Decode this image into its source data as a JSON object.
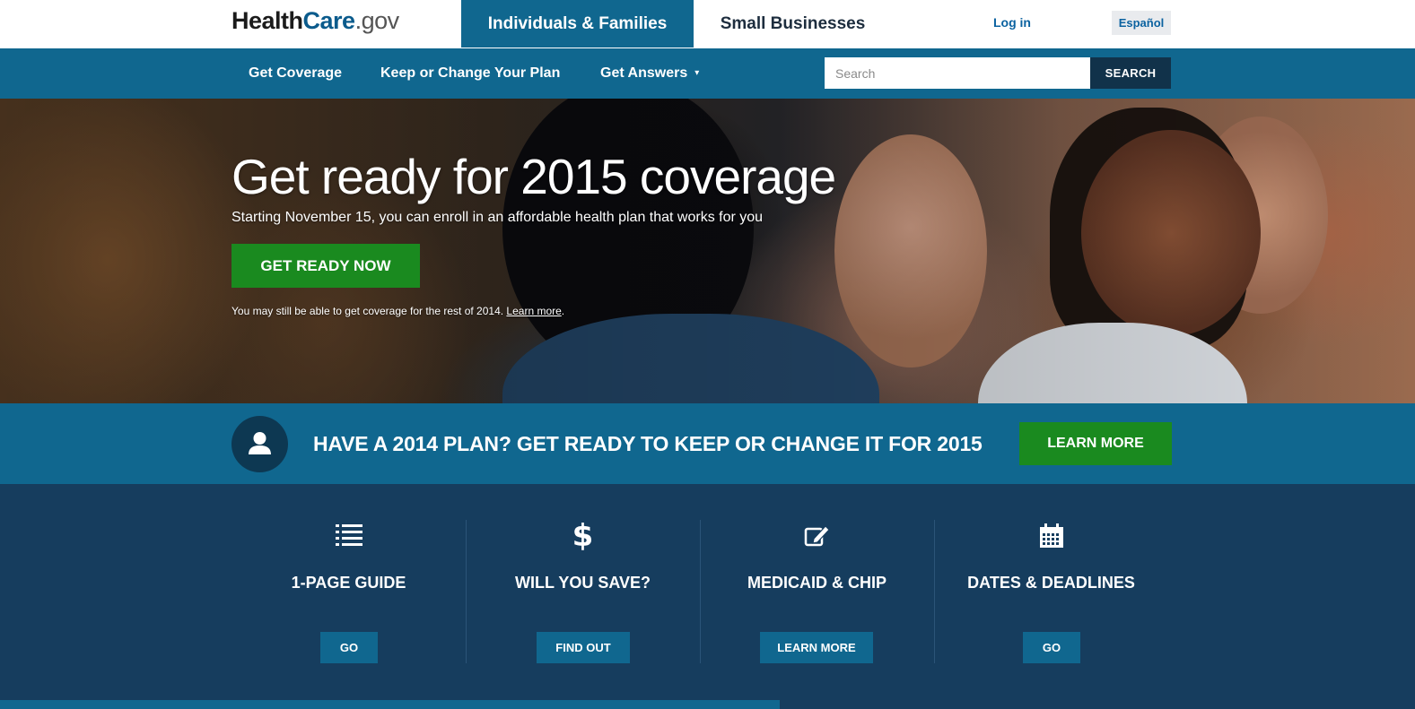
{
  "header": {
    "logo": {
      "part1": "Health",
      "part2": "Care",
      "part3": ".gov"
    },
    "tabs": [
      {
        "label": "Individuals & Families",
        "active": true
      },
      {
        "label": "Small Businesses",
        "active": false
      }
    ],
    "login_label": "Log in",
    "language_label": "Español"
  },
  "nav": {
    "items": [
      {
        "label": "Get Coverage"
      },
      {
        "label": "Keep or Change Your Plan"
      },
      {
        "label": "Get Answers",
        "has_dropdown": true
      }
    ],
    "search": {
      "placeholder": "Search",
      "value": "",
      "button_label": "SEARCH"
    }
  },
  "hero": {
    "title": "Get ready for 2015 coverage",
    "subtitle": "Starting November 15, you can enroll in an affordable health plan that works for you",
    "cta_label": "GET READY NOW",
    "note_text": "You may still be able to get coverage for the rest of 2014. ",
    "note_link": "Learn more",
    "note_end": "."
  },
  "plan_banner": {
    "icon": "person-icon",
    "text": "HAVE A 2014 PLAN? GET READY TO KEEP OR CHANGE IT FOR 2015",
    "button_label": "LEARN MORE"
  },
  "features": [
    {
      "icon": "list-icon",
      "title": "1-PAGE GUIDE",
      "button_label": "GO"
    },
    {
      "icon": "dollar-icon",
      "title": "WILL YOU SAVE?",
      "button_label": "FIND OUT"
    },
    {
      "icon": "edit-icon",
      "title": "MEDICAID & CHIP",
      "button_label": "LEARN MORE"
    },
    {
      "icon": "calendar-icon",
      "title": "DATES & DEADLINES",
      "button_label": "GO"
    }
  ],
  "colors": {
    "primary_blue": "#10678f",
    "dark_navy": "#163d5e",
    "green": "#1a8a1f",
    "search_button": "#11324a"
  }
}
